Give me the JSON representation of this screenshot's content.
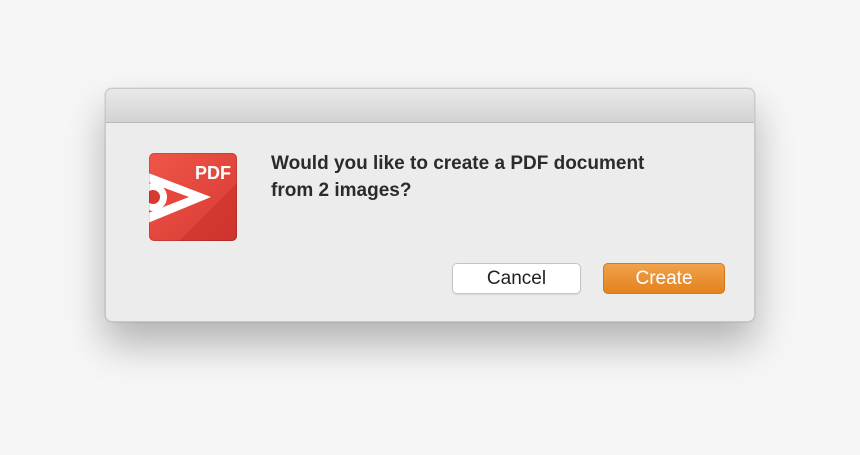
{
  "dialog": {
    "message_line1": "Would you like to create a PDF document",
    "message_line2": "from 2 images?",
    "cancel_label": "Cancel",
    "create_label": "Create"
  },
  "app_icon": {
    "icon_name": "pdf-expert-app-icon",
    "label": "PDF",
    "colors": {
      "red": "#e8453c",
      "dark_red": "#c8302a",
      "white": "#ffffff"
    }
  },
  "colors": {
    "accent_button": "#e88b2a",
    "dialog_background": "#ececec",
    "page_background": "#f6f6f6"
  }
}
